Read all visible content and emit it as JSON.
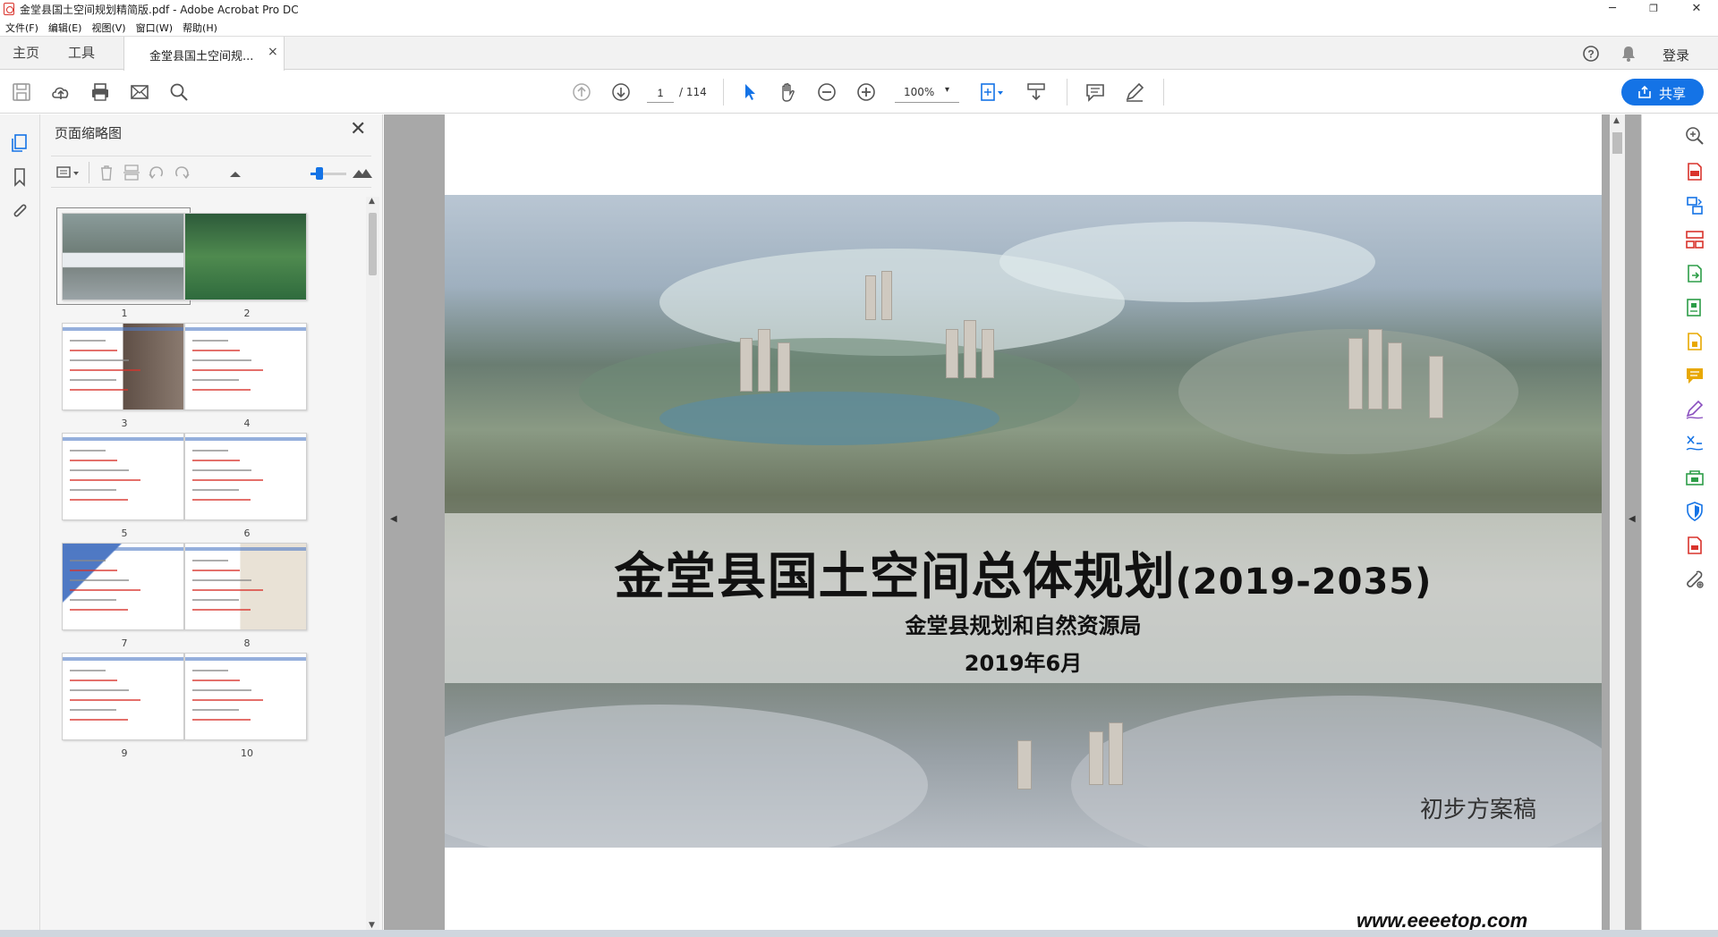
{
  "window": {
    "title": "金堂县国土空间规划精简版.pdf - Adobe Acrobat Pro DC",
    "minimize": "─",
    "restore": "❐",
    "close": "✕"
  },
  "menu": [
    "文件(F)",
    "编辑(E)",
    "视图(V)",
    "窗口(W)",
    "帮助(H)"
  ],
  "tabs": {
    "home": "主页",
    "tools": "工具",
    "document": "金堂县国土空间规...",
    "document_close": "×",
    "login": "登录"
  },
  "toolbar": {
    "page_current": "1",
    "page_total": "/ 114",
    "zoom": "100%",
    "zoom_caret": "▾",
    "share": "共享",
    "icons": [
      "save-icon",
      "cloud-upload-icon",
      "print-icon",
      "email-icon",
      "search-icon",
      "prev-page-icon",
      "next-page-icon",
      "select-arrow-icon",
      "hand-icon",
      "zoom-out-icon",
      "zoom-in-icon",
      "fit-page-icon",
      "scroll-mode-icon",
      "comment-icon",
      "pen-icon"
    ]
  },
  "left_nav": {
    "icons": [
      "page-thumbnails-icon",
      "bookmarks-icon",
      "attachments-icon"
    ]
  },
  "thumbnail_panel": {
    "title": "页面缩略图",
    "close": "✕",
    "pages": [
      "1",
      "2",
      "3",
      "4",
      "5",
      "6",
      "7",
      "8",
      "9",
      "10"
    ],
    "selected_page": "1",
    "size_level": 0.25
  },
  "document": {
    "title_main": "金堂县国土空间总体规划",
    "title_years": "(2019-2035)",
    "subtitle_org": "金堂县规划和自然资源局",
    "subtitle_date": "2019年6月",
    "draft_label": "初步方案稿"
  },
  "right_tools": {
    "icons": [
      "zoom-tool-icon",
      "create-pdf-icon",
      "combine-files-icon",
      "organize-pages-icon",
      "export-pdf-icon",
      "edit-pdf-icon",
      "send-for-review-icon",
      "comment-tool-icon",
      "fill-sign-icon",
      "protect-icon",
      "print-production-icon",
      "shield-icon",
      "more-pdf-icon",
      "tools-wrench-icon"
    ]
  },
  "watermark": "www.eeeetop.com",
  "colors": {
    "accent": "#1473e6",
    "red_tool": "#d9332c",
    "green_tool": "#2d9d48",
    "yellow_tool": "#e8a800"
  }
}
